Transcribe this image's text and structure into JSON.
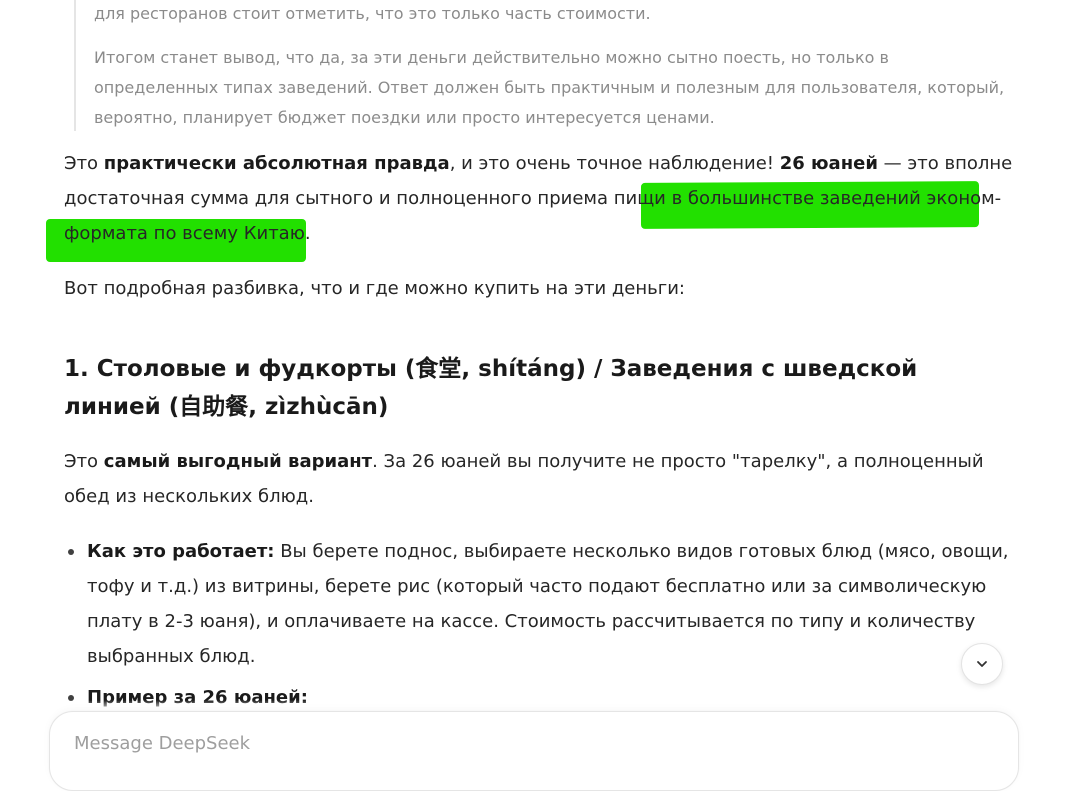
{
  "thinking": {
    "para1": "для ресторанов стоит отметить, что это только часть стоимости.",
    "para2": "Итогом станет вывод, что да, за эти деньги действительно можно сытно поесть, но только в определенных типах заведений. Ответ должен быть практичным и полезным для пользователя, который, вероятно, планирует бюджет поездки или просто интересуется ценами."
  },
  "answer": {
    "intro": {
      "t1": "Это ",
      "b1": "практически абсолютная правда",
      "t2": ", и это очень точное наблюдение! ",
      "b2": "26 юаней",
      "t3": " — это вполне достаточная сумма для сытного и полноценного приема пищи ",
      "highlighted": "в большинстве заведений эконом-формата по всему Китаю."
    },
    "breakdown": "Вот подробная разбивка, что и где можно купить на эти деньги:",
    "heading": "1. Столовые и фудкорты (食堂, shítáng) / Заведения с шведской линией (自助餐, zìzhùcān)",
    "section_intro": {
      "t1": "Это ",
      "b1": "самый выгодный вариант",
      "t2": ". За 26 юаней вы получите не просто \"тарелку\", а полноценный обед из нескольких блюд."
    },
    "bullets": [
      {
        "label": "Как это работает:",
        "text": " Вы берете поднос, выбираете несколько видов готовых блюд (мясо, овощи, тофу и т.д.) из витрины, берете рис (который часто подают бесплатно или за символическую плату в 2-3 юаня), и оплачиваете на кассе. Стоимость рассчитывается по типу и количеству выбранных блюд."
      },
      {
        "label": "Пример за 26 юаней:",
        "text": ""
      }
    ]
  },
  "scroll_button": {
    "icon": "chevron-down-icon"
  },
  "composer": {
    "placeholder": "Message DeepSeek"
  },
  "colors": {
    "highlight": "#22e000",
    "text": "#262626",
    "muted": "#8b8b8b"
  }
}
